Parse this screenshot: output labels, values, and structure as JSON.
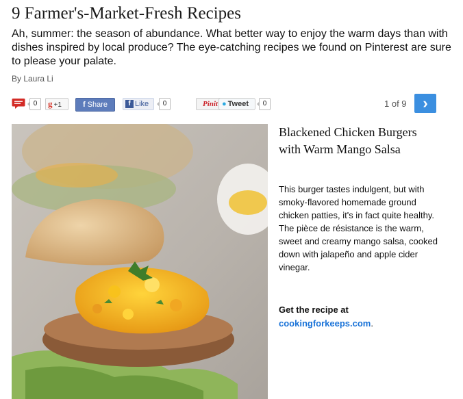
{
  "article": {
    "title": "9 Farmer's-Market-Fresh Recipes",
    "intro": "Ah, summer: the season of abundance. What better way to enjoy the warm days than with dishes inspired by local produce? The eye-catching recipes we found on Pinterest are sure to please your palate.",
    "byline": "By Laura Li"
  },
  "share_bar": {
    "comment_count": "0",
    "gplus_label": "+1",
    "gplus_g": "g",
    "fb_share_label": "Share",
    "fb_share_f": "f",
    "fb_like_label": "Like",
    "fb_like_f": "f",
    "fb_like_count": "0",
    "pinit_label": "Pinit",
    "tweet_label": "Tweet",
    "tweet_count": "0",
    "pager_text": "1 of 9",
    "next_symbol": "›",
    "colors": {
      "next_button": "#3b8fe0",
      "fb_share": "#5d7cbb",
      "comment_icon": "#d32b26",
      "link": "#1a73d8"
    },
    "icons": {
      "comment": "comment-icon",
      "next": "chevron-right-icon",
      "twitter": "twitter-bird-icon"
    }
  },
  "slide": {
    "title": "Blackened Chicken Burgers with Warm Mango Salsa",
    "description": "This burger tastes indulgent, but with smoky-flavored homemade ground chicken patties, it's in fact quite healthy. The pièce de résistance is the warm, sweet and creamy mango salsa, cooked down with jalapeño and apple cider vinegar.",
    "cta_prefix": "Get the recipe at",
    "link_text": "cookingforkeeps.com",
    "cta_suffix": "."
  }
}
